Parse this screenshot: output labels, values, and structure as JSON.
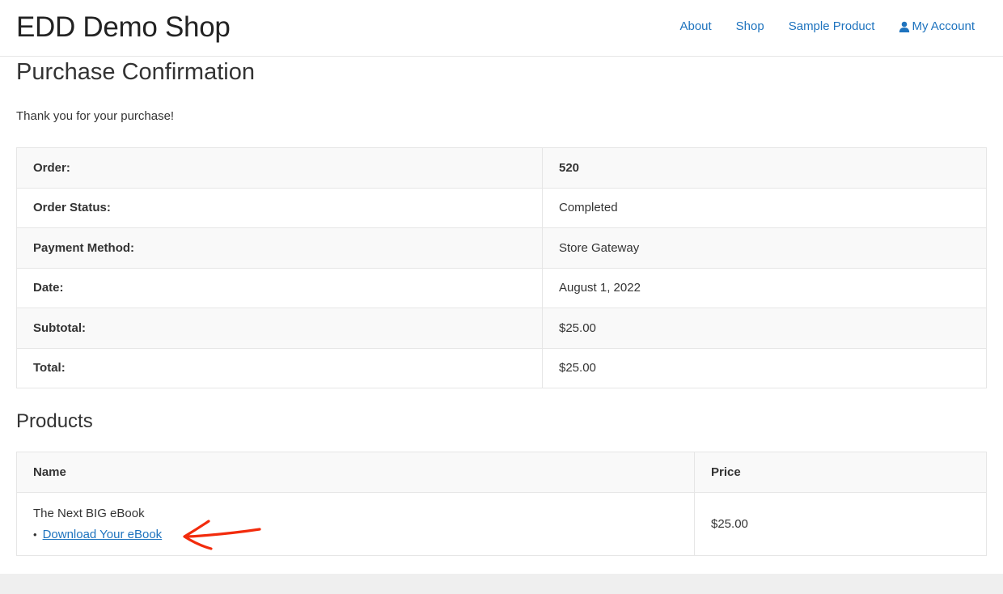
{
  "header": {
    "site_title": "EDD Demo Shop",
    "nav": {
      "about": "About",
      "shop": "Shop",
      "sample_product": "Sample Product",
      "my_account": "My Account"
    }
  },
  "page": {
    "title": "Purchase Confirmation",
    "thanks": "Thank you for your purchase!"
  },
  "receipt": {
    "rows": [
      {
        "label": "Order:",
        "value": "520"
      },
      {
        "label": "Order Status:",
        "value": "Completed"
      },
      {
        "label": "Payment Method:",
        "value": "Store Gateway"
      },
      {
        "label": "Date:",
        "value": "August 1, 2022"
      },
      {
        "label": "Subtotal:",
        "value": "$25.00"
      },
      {
        "label": "Total:",
        "value": "$25.00"
      }
    ]
  },
  "products": {
    "heading": "Products",
    "columns": {
      "name": "Name",
      "price": "Price"
    },
    "items": [
      {
        "name": "The Next BIG eBook",
        "download_label": "Download Your eBook",
        "price": "$25.00"
      }
    ]
  },
  "colors": {
    "link": "#1e73be",
    "annotation_arrow": "#f22b0c",
    "table_stripe": "#f9f9f9",
    "border": "#e6e6e6"
  },
  "icons": {
    "account": "user-icon",
    "annotation": "hand-drawn-arrow-icon"
  }
}
